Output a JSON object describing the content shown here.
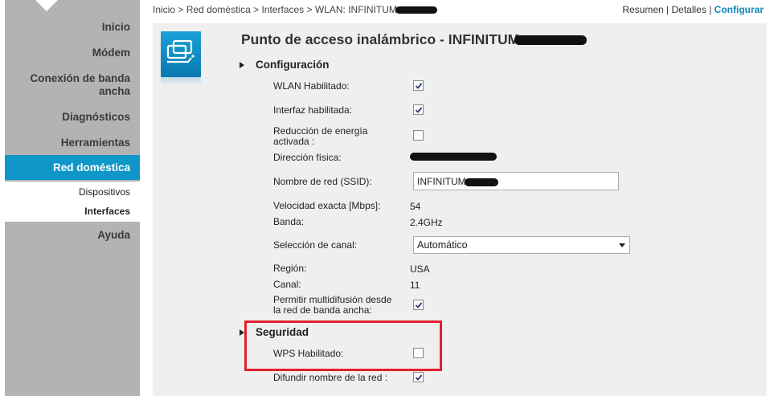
{
  "sidebar": {
    "items": [
      {
        "label": "Inicio"
      },
      {
        "label": "Módem"
      },
      {
        "label": "Conexión de banda ancha"
      },
      {
        "label": "Diagnósticos"
      },
      {
        "label": "Herramientas"
      }
    ],
    "active": {
      "label": "Red doméstica"
    },
    "subitems": [
      {
        "label": "Dispositivos"
      },
      {
        "label": "Interfaces"
      }
    ],
    "after": {
      "label": "Ayuda"
    }
  },
  "breadcrumb": {
    "home": "Inicio",
    "sep": ">",
    "network": "Red doméstica",
    "interfaces": "Interfaces",
    "current": "WLAN: INFINITUM"
  },
  "view_links": {
    "summary": "Resumen",
    "separator": "|",
    "details": "Detalles",
    "configure": "Configurar"
  },
  "page": {
    "title": "Punto de acceso inalámbrico - INFINITUM"
  },
  "config": {
    "heading": "Configuración",
    "wlan_enabled": {
      "label": "WLAN Habilitado:",
      "checked": true
    },
    "iface_enabled": {
      "label": "Interfaz habilitada:",
      "checked": true
    },
    "power_reduction": {
      "label_line1": "Reducción de energía",
      "label_line2": "activada :",
      "checked": false
    },
    "mac": {
      "label": "Dirección física:"
    },
    "ssid": {
      "label": "Nombre de red (SSID):",
      "value": "INFINITUM"
    },
    "speed": {
      "label": "Velocidad exacta [Mbps]:",
      "value": "54"
    },
    "band": {
      "label": "Banda:",
      "value": "2.4GHz"
    },
    "channel_select": {
      "label": "Selección de canal:",
      "value": "Automático"
    },
    "region": {
      "label": "Región:",
      "value": "USA"
    },
    "channel": {
      "label": "Canal:",
      "value": "11"
    },
    "multicast": {
      "label_line1": "Permitir multidifusión desde",
      "label_line2": "la red de banda ancha:",
      "checked": true
    }
  },
  "security": {
    "heading": "Seguridad",
    "wps": {
      "label": "WPS Habilitado:",
      "checked": false
    },
    "broadcast": {
      "label": "Difundir nombre de la red :",
      "checked": true
    }
  },
  "colors": {
    "accent": "#0e97c8",
    "highlight": "#e0202a",
    "sidebar_bg": "#b3b3b3",
    "panel_bg": "#efefef"
  }
}
